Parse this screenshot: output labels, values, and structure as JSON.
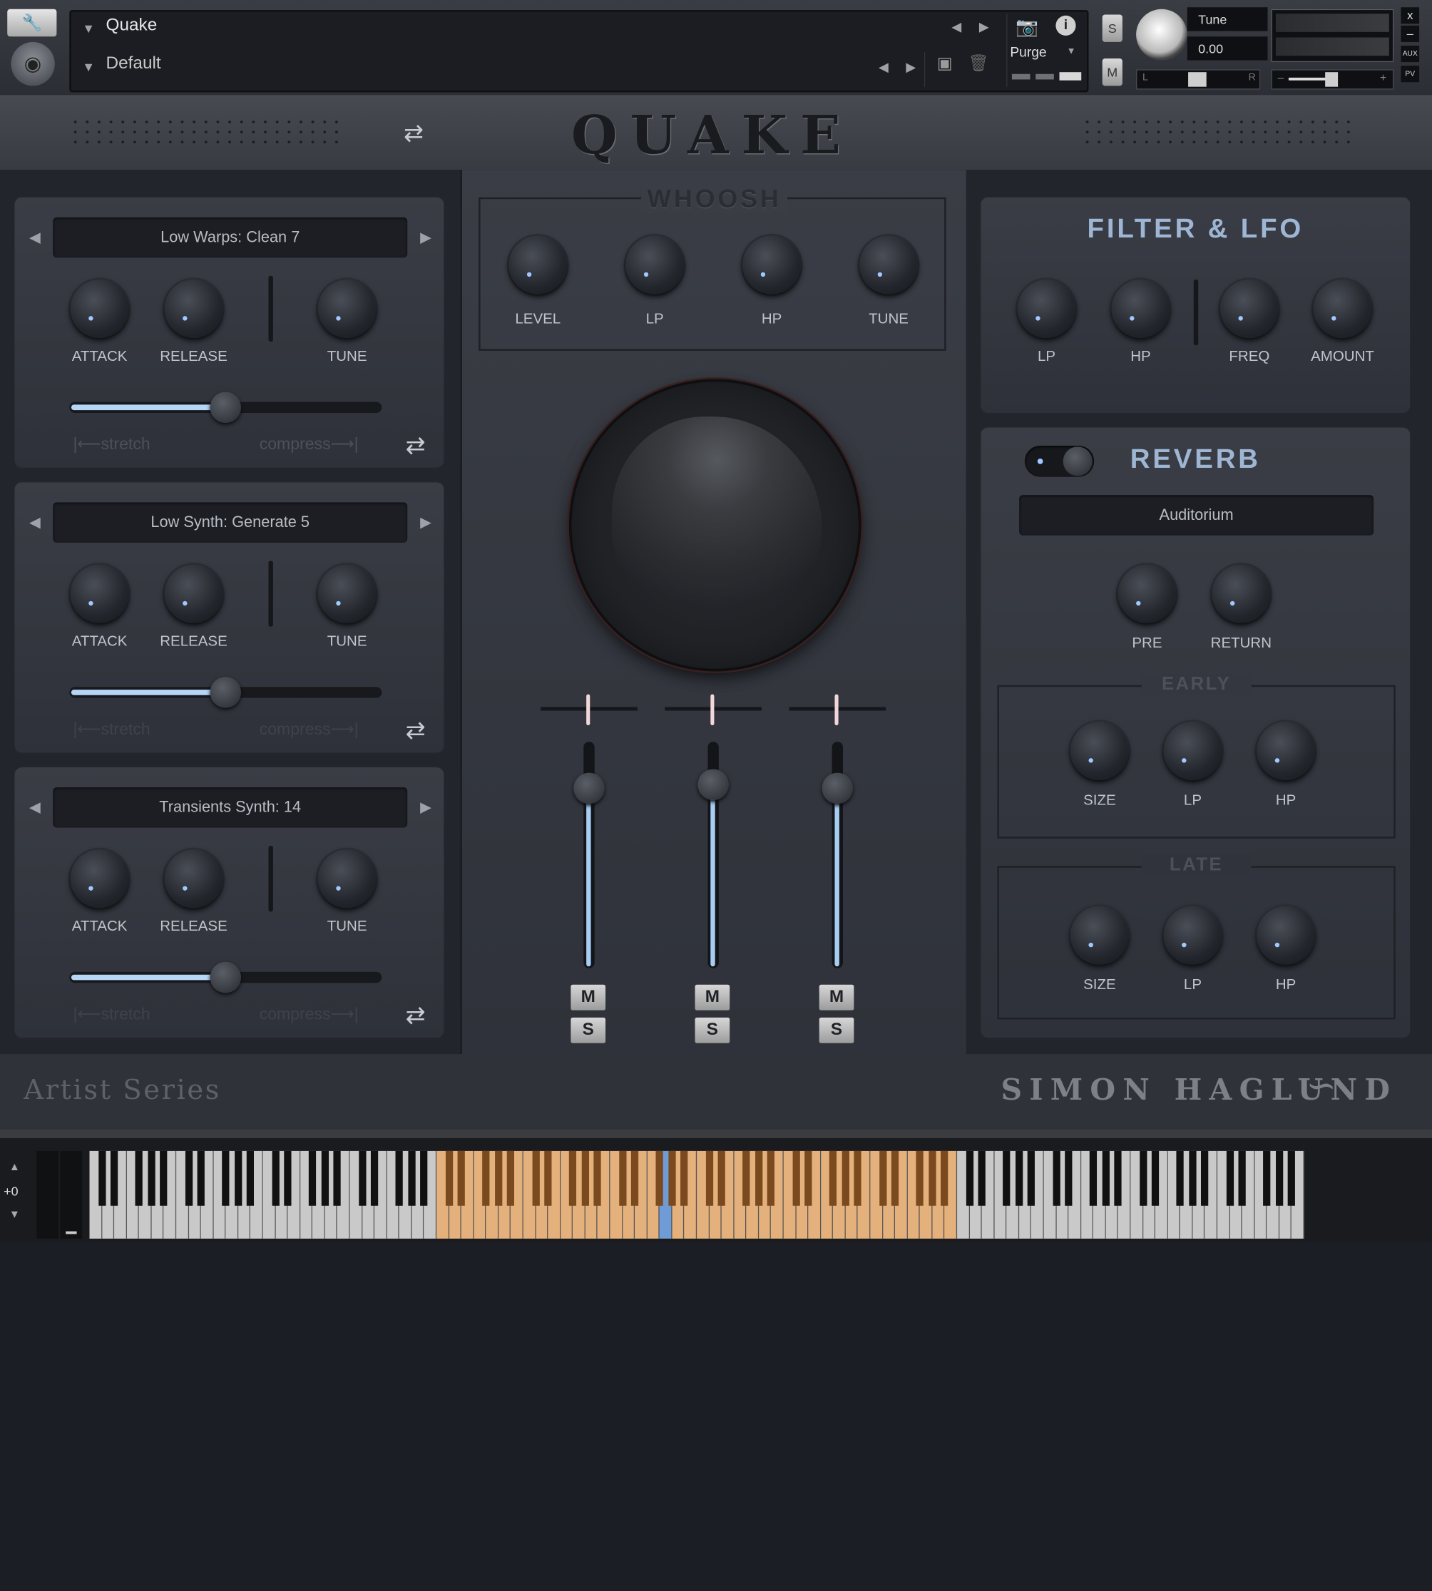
{
  "header": {
    "instrument_name": "Quake",
    "snapshot_name": "Default",
    "purge_label": "Purge",
    "tune_label": "Tune",
    "tune_value": "0.00",
    "solo_label": "S",
    "mute_label": "M",
    "pan_left": "L",
    "pan_right": "R",
    "aux_label": "AUX",
    "pv_label": "PV",
    "close_label": "x",
    "minimize_label": "–",
    "vol_minus": "–",
    "vol_plus": "+"
  },
  "title": {
    "logo_text": "QUAKE"
  },
  "layers": [
    {
      "preset": "Low Warps: Clean 7",
      "knobs": [
        "ATTACK",
        "RELEASE",
        "TUNE"
      ],
      "stretch": "stretch",
      "compress": "compress",
      "slider_value": 0.5
    },
    {
      "preset": "Low Synth: Generate 5",
      "knobs": [
        "ATTACK",
        "RELEASE",
        "TUNE"
      ],
      "stretch": "stretch",
      "compress": "compress",
      "slider_value": 0.5
    },
    {
      "preset": "Transients Synth: 14",
      "knobs": [
        "ATTACK",
        "RELEASE",
        "TUNE"
      ],
      "stretch": "stretch",
      "compress": "compress",
      "slider_value": 0.5
    }
  ],
  "whoosh": {
    "title": "WHOOSH",
    "knobs": [
      "LEVEL",
      "LP",
      "HP",
      "TUNE"
    ]
  },
  "mixer": {
    "channels": [
      {
        "mute": "M",
        "solo": "S",
        "level": 0.82
      },
      {
        "mute": "M",
        "solo": "S",
        "level": 0.84
      },
      {
        "mute": "M",
        "solo": "S",
        "level": 0.82
      }
    ]
  },
  "filter_lfo": {
    "title": "FILTER  &  LFO",
    "knobs": [
      "LP",
      "HP",
      "FREQ",
      "AMOUNT"
    ]
  },
  "reverb": {
    "title": "REVERB",
    "preset": "Auditorium",
    "knobs": [
      "PRE",
      "RETURN"
    ],
    "early": {
      "title": "EARLY",
      "knobs": [
        "SIZE",
        "LP",
        "HP"
      ]
    },
    "late": {
      "title": "LATE",
      "knobs": [
        "SIZE",
        "LP",
        "HP"
      ]
    }
  },
  "footer": {
    "series": "Artist Series",
    "artist": "SIMON HAGLUND"
  },
  "keyboard": {
    "octave": "+0"
  },
  "colors": {
    "accent_blue": "#9eb6d4",
    "slider_fill": "#b6d6f6",
    "key_active": "#e4b07c",
    "key_selected": "#6f9cd6"
  }
}
